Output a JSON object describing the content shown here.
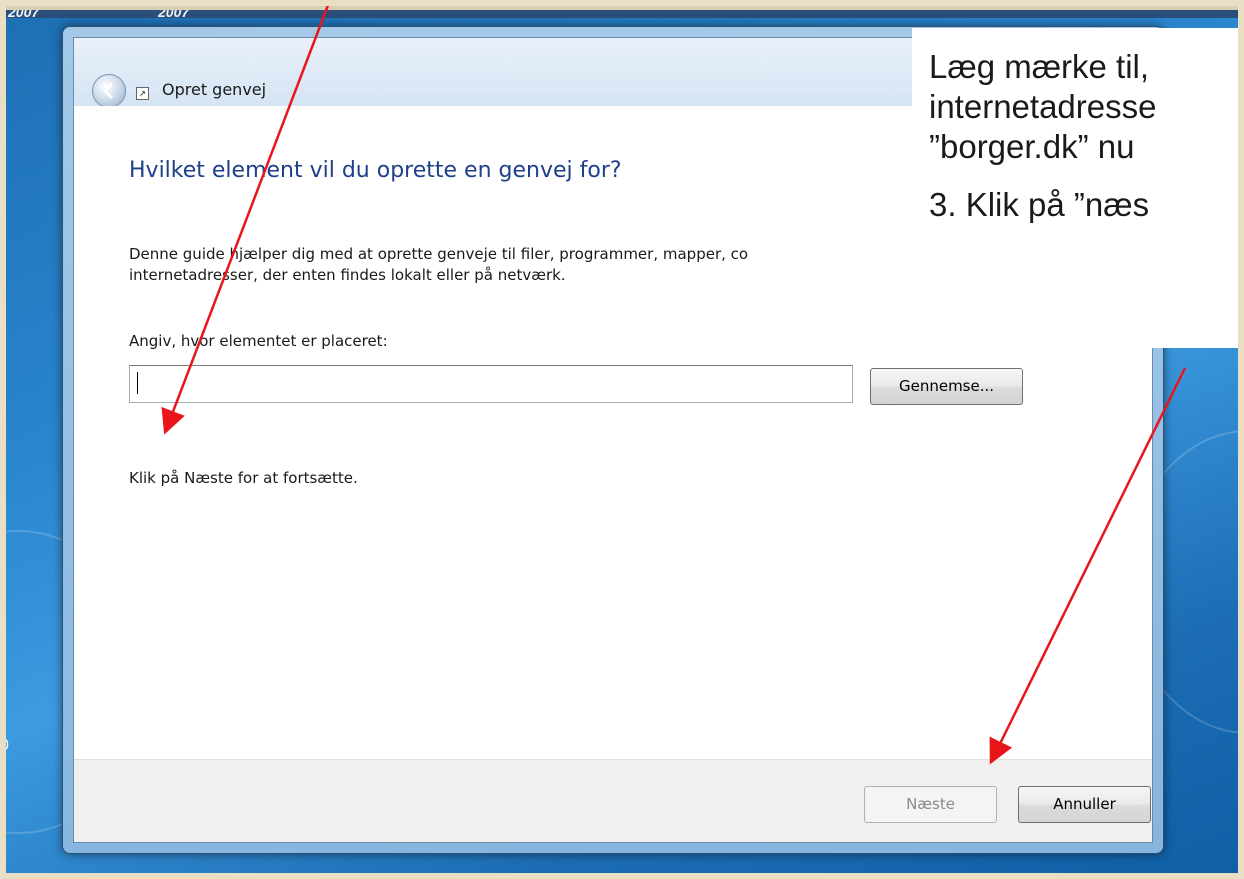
{
  "desktop": {
    "top_labels": [
      "2007",
      "2007"
    ],
    "left_label": "0"
  },
  "window": {
    "title": "Opret genvej",
    "heading": "Hvilket element vil du oprette en genvej for?",
    "description_line1": "Denne guide hjælper dig med at oprette genveje til filer, programmer, mapper, co",
    "description_line2": "internetadresser, der enten findes lokalt eller på netværk.",
    "location_label": "Angiv, hvor elementet er placeret:",
    "location_value": "",
    "browse_label": "Gennemse...",
    "hint": "Klik på Næste for at fortsætte.",
    "next_label": "Næste",
    "cancel_label": "Annuller",
    "next_enabled": false
  },
  "annotation": {
    "line1": "Læg mærke til,",
    "line2": "internetadresse",
    "line3": "”borger.dk” nu",
    "step": "3. Klik på ”næs",
    "arrow_color": "#e8161b"
  }
}
